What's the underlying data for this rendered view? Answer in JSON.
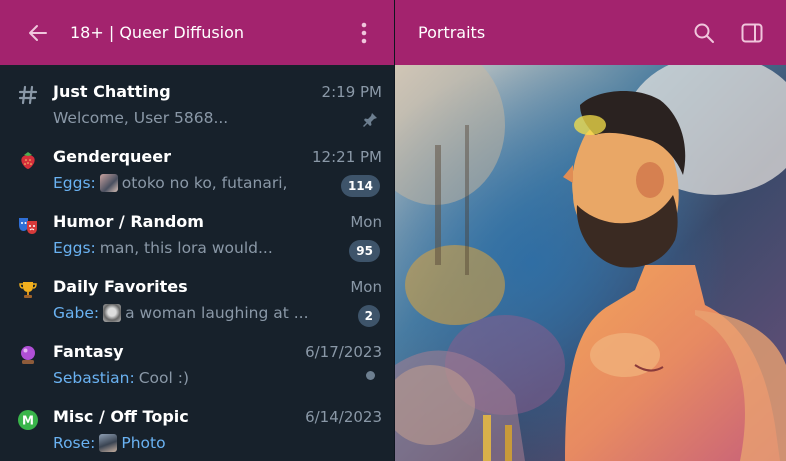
{
  "header": {
    "title": "18+ | Queer Diffusion",
    "right_title": "Portraits",
    "icons": {
      "back": "arrow-left-icon",
      "menu": "more-vertical-icon",
      "search": "search-icon",
      "panel": "sidebar-panel-icon"
    }
  },
  "topics": [
    {
      "name": "Just Chatting",
      "time": "2:19 PM",
      "preview_sender": "",
      "preview_text": "Welcome,  User 5868...",
      "icon": "hash-icon",
      "status": "pinned"
    },
    {
      "name": "Genderqueer",
      "time": "12:21 PM",
      "preview_sender": "Eggs:",
      "preview_text": "otoko no ko, futanari,",
      "icon": "strawberry-icon",
      "badge": "114",
      "thumb": true
    },
    {
      "name": "Humor / Random",
      "time": "Mon",
      "preview_sender": "Eggs:",
      "preview_text": "man, this lora would...",
      "icon": "theater-masks-icon",
      "badge": "95"
    },
    {
      "name": "Daily Favorites",
      "time": "Mon",
      "preview_sender": "Gabe:",
      "preview_text": "a woman laughing at ...",
      "icon": "trophy-icon",
      "badge": "2",
      "thumb": true
    },
    {
      "name": "Fantasy",
      "time": "6/17/2023",
      "preview_sender": "Sebastian:",
      "preview_text": "Cool :)",
      "icon": "crystal-ball-icon",
      "status": "unread-dot"
    },
    {
      "name": "Misc / Off Topic",
      "time": "6/14/2023",
      "preview_sender": "Rose:",
      "preview_text": "Photo",
      "icon": "m-badge-icon",
      "thumb": true,
      "preview_is_media": true
    }
  ],
  "colors": {
    "header_bg": "#a3236e",
    "sidebar_bg": "#17212b",
    "accent_text": "#6ab2f2",
    "muted_text": "#8a98a7",
    "badge_bg": "#3e546a"
  }
}
